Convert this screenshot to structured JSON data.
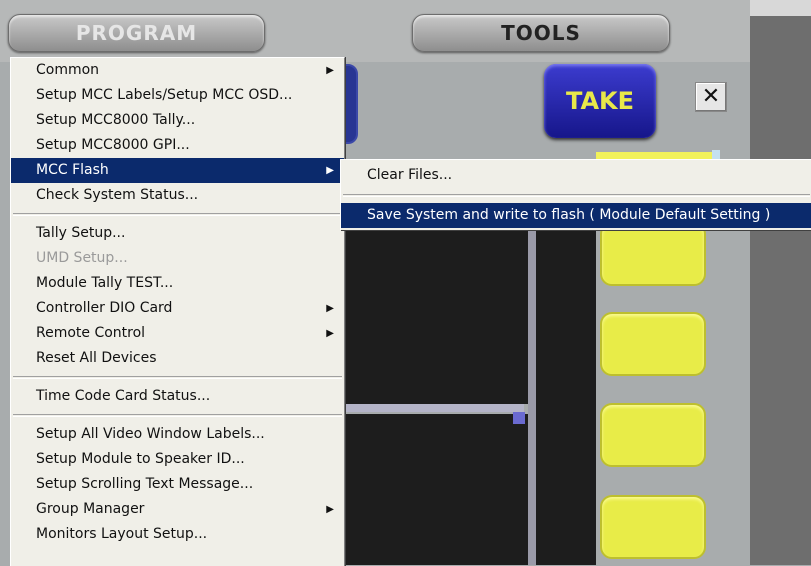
{
  "tabs": {
    "program_label": "PROGRAM",
    "tools_label": "TOOLS"
  },
  "take_label": "TAKE",
  "close_glyph": "✕",
  "menu": {
    "items": [
      {
        "label": "Common",
        "submenu": true
      },
      {
        "label": "Setup MCC Labels/Setup MCC OSD..."
      },
      {
        "label": "Setup MCC8000 Tally..."
      },
      {
        "label": "Setup MCC8000 GPI..."
      },
      {
        "label": "MCC Flash",
        "submenu": true,
        "selected": true
      },
      {
        "label": "Check System Status..."
      },
      {
        "label": "Tally Setup..."
      },
      {
        "label": "UMD Setup...",
        "disabled": true
      },
      {
        "label": "Module Tally TEST..."
      },
      {
        "label": "Controller DIO Card",
        "submenu": true
      },
      {
        "label": "Remote Control",
        "submenu": true
      },
      {
        "label": "Reset  All  Devices"
      },
      {
        "label": "Time Code Card Status..."
      },
      {
        "label": "Setup All Video Window Labels..."
      },
      {
        "label": "Setup Module to Speaker ID..."
      },
      {
        "label": "Setup Scrolling Text Message..."
      },
      {
        "label": "Group Manager",
        "submenu": true
      },
      {
        "label": "Monitors Layout Setup..."
      }
    ],
    "submenu_arrow": "▶"
  },
  "submenu": {
    "items": [
      {
        "label": "Clear Files..."
      },
      {
        "label": "Save System and write to flash ( Module Default Setting )",
        "selected": true
      }
    ]
  },
  "colors": {
    "menu_highlight": "#0b2a6c",
    "take_bg": "#2020a8",
    "take_text": "#e8e84a",
    "yellow_button": "#e8ec48"
  }
}
